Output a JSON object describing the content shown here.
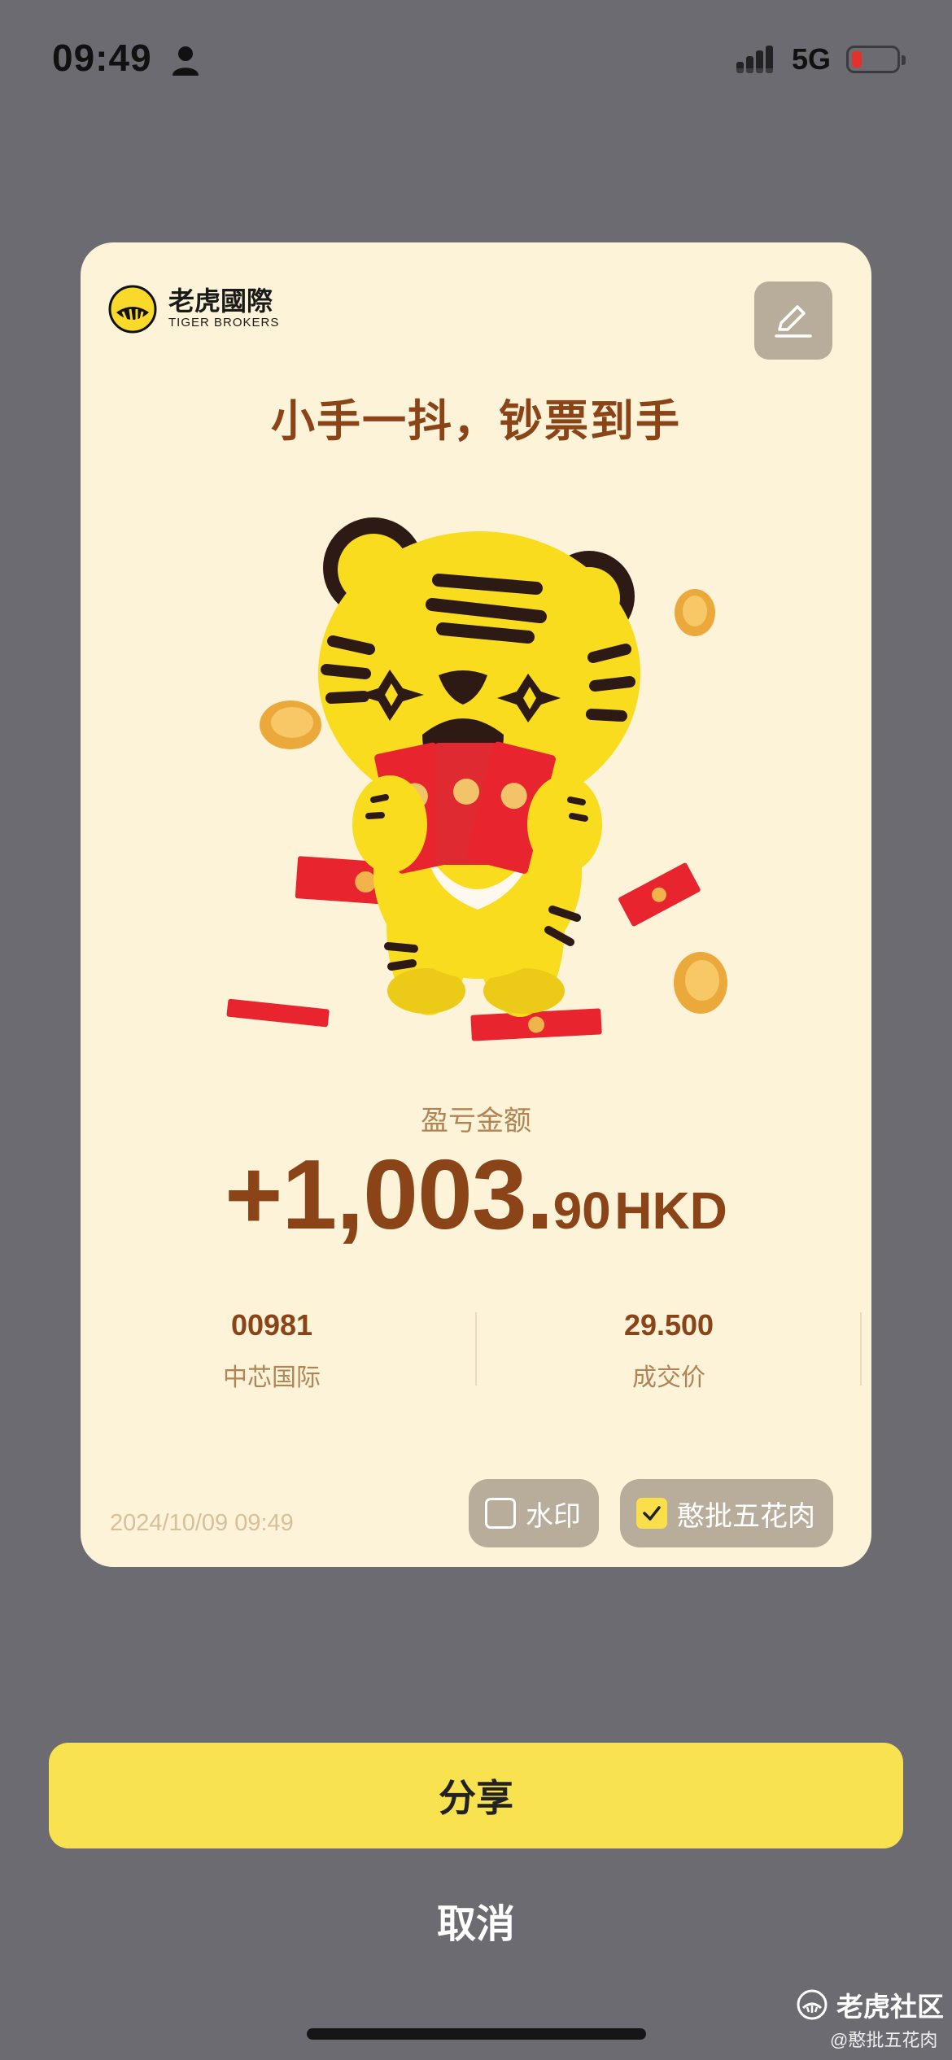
{
  "status_bar": {
    "time": "09:49",
    "network": "5G",
    "battery_color": "#e4312b"
  },
  "card": {
    "brand_cn": "老虎國際",
    "brand_en": "TIGER BROKERS",
    "headline": "小手一抖，钞票到手",
    "pl_label": "盈亏金额",
    "pl_amount_main": "+1,003.",
    "pl_amount_decimal": "90",
    "pl_currency": "HKD",
    "stats": [
      {
        "value": "00981",
        "label": "中芯国际"
      },
      {
        "value": "29.500",
        "label": "成交价"
      }
    ],
    "date": "2024/10/09 09:49",
    "options": [
      {
        "label": "水印",
        "checked": false
      },
      {
        "label": "憨批五花肉",
        "checked": true
      }
    ]
  },
  "actions": {
    "share": "分享",
    "cancel": "取消"
  },
  "watermark": {
    "site": "老虎社区",
    "user": "@憨批五花肉"
  },
  "colors": {
    "accent_yellow": "#f9e250",
    "text_brown": "#8b4418",
    "card_bg": "#fdf3d8",
    "overlay": "#6c6b72"
  },
  "icons": [
    "person-icon",
    "signal-icon",
    "battery-icon",
    "tiger-logo-icon",
    "edit-icon",
    "checkbox-icon",
    "community-icon"
  ]
}
